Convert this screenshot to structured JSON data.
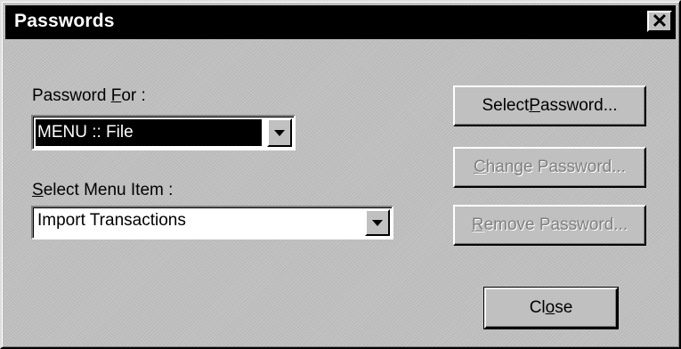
{
  "window": {
    "title": "Passwords",
    "close_symbol": "✕"
  },
  "password_for": {
    "label_before": "Password ",
    "label_accel": "F",
    "label_after": "or :",
    "selected_value": "MENU :: File"
  },
  "menu_item": {
    "label_before": "",
    "label_accel": "S",
    "label_after": "elect Menu Item :",
    "selected_value": "Import Transactions"
  },
  "buttons": {
    "select": {
      "before": "Select ",
      "accel": "P",
      "after": "assword...",
      "enabled": true
    },
    "change": {
      "before": "",
      "accel": "C",
      "after": "hange Password...",
      "enabled": false
    },
    "remove": {
      "before": "",
      "accel": "R",
      "after": "emove Password...",
      "enabled": false
    },
    "close": {
      "before": "Cl",
      "accel": "o",
      "after": "se",
      "enabled": true
    }
  },
  "icons": {
    "dropdown": "chevron-down-icon",
    "close": "close-icon"
  }
}
